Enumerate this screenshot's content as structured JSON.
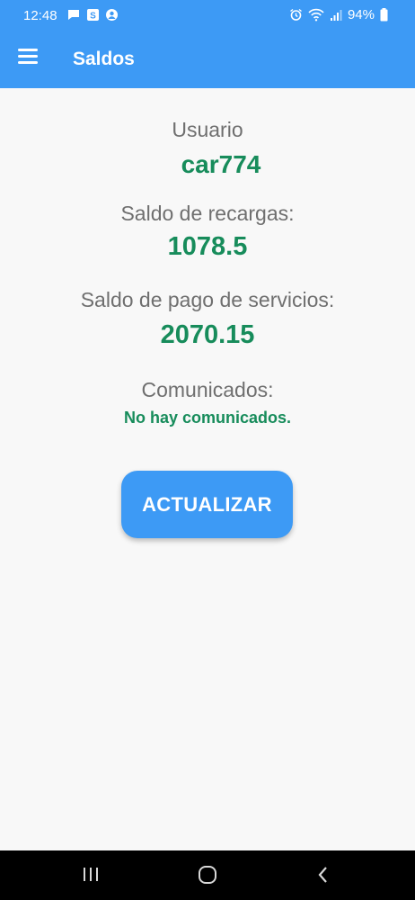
{
  "status": {
    "time": "12:48",
    "battery": "94%",
    "left_icons": [
      "message-icon",
      "s-app-icon",
      "account-icon"
    ],
    "right_icons": [
      "alarm-icon",
      "wifi-icon",
      "signal-icon",
      "battery-icon"
    ]
  },
  "appbar": {
    "title": "Saldos",
    "menu_icon": "hamburger-menu-icon"
  },
  "user": {
    "label": "Usuario",
    "value": "car774"
  },
  "recharge": {
    "label": "Saldo de recargas:",
    "value": "1078.5"
  },
  "services": {
    "label": "Saldo de pago de servicios:",
    "value": "2070.15"
  },
  "announcements": {
    "label": "Comunicados:",
    "value": "No hay comunicados."
  },
  "action": {
    "update_label": "ACTUALIZAR"
  },
  "navbar": {
    "icons": [
      "recent-apps-icon",
      "home-icon",
      "back-icon"
    ]
  },
  "colors": {
    "primary": "#3d9af5",
    "value_green": "#178c5b",
    "label_gray": "#6f6f6f",
    "background": "#f8f8f8"
  }
}
